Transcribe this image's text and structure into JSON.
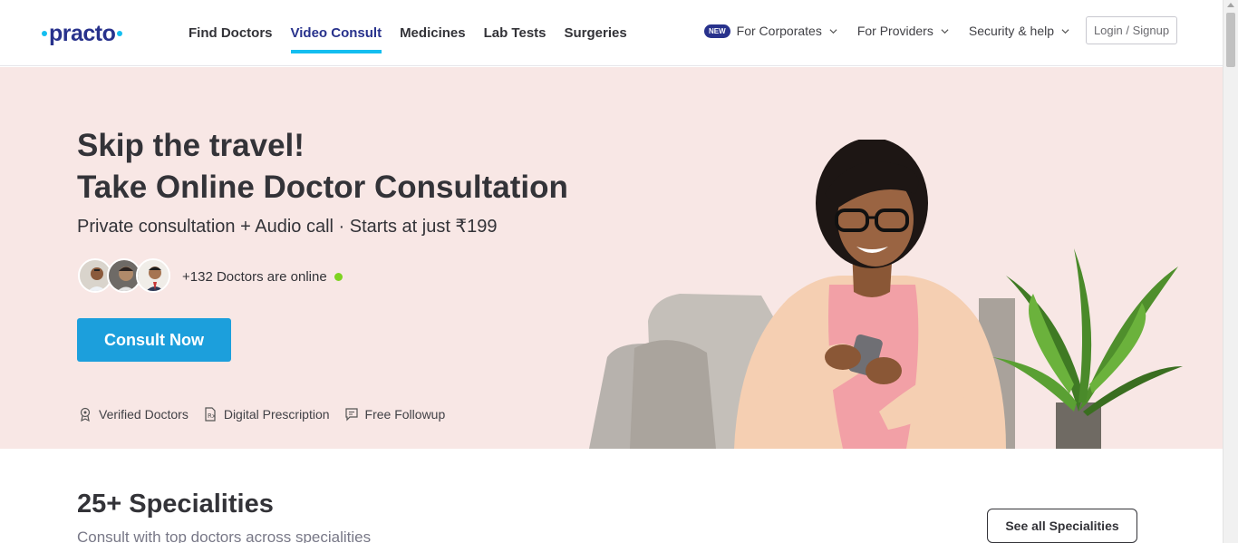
{
  "header": {
    "logo_text": "practo",
    "nav": [
      "Find Doctors",
      "Video Consult",
      "Medicines",
      "Lab Tests",
      "Surgeries"
    ],
    "active_nav": "Video Consult",
    "badge_new": "NEW",
    "for_corporates": "For Corporates",
    "for_providers": "For Providers",
    "security_help": "Security & help",
    "login": "Login / Signup"
  },
  "hero": {
    "title_line1": "Skip the travel!",
    "title_line2": "Take Online Doctor Consultation",
    "subtitle": "Private consultation + Audio call · Starts at just ₹199",
    "online_text": "+132 Doctors are online",
    "cta": "Consult Now",
    "features": [
      "Verified Doctors",
      "Digital Prescription",
      "Free Followup"
    ]
  },
  "specialities": {
    "title": "25+ Specialities",
    "subtitle": "Consult with top doctors across specialities",
    "see_all": "See all Specialities"
  },
  "colors": {
    "brand": "#28328c",
    "accent": "#14bef0",
    "cta": "#1c9fdc",
    "hero_bg": "#f8e7e5",
    "online": "#7ed321"
  }
}
